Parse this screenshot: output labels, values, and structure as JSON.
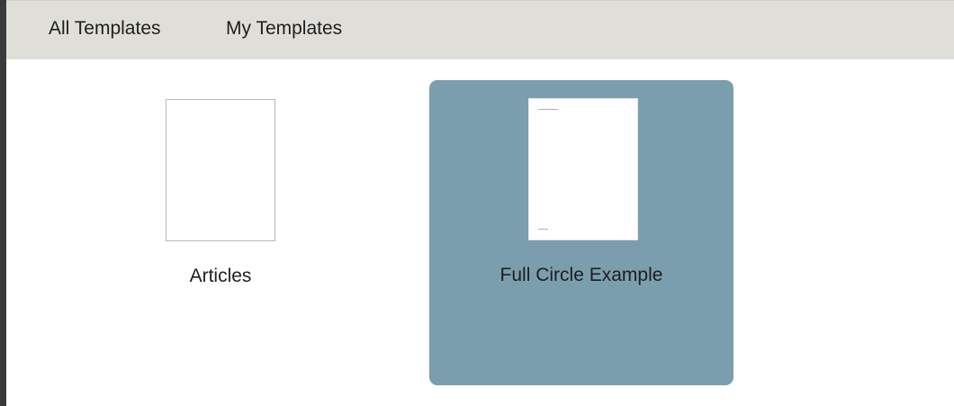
{
  "tabs": [
    {
      "label": "All Templates"
    },
    {
      "label": "My Templates"
    }
  ],
  "templates": [
    {
      "label": "Articles",
      "selected": false
    },
    {
      "label": "Full Circle Example",
      "selected": true
    }
  ],
  "colors": {
    "tabbar_background": "#dfded9",
    "selection_background": "#7b9eae",
    "left_border": "#3a3a3a",
    "text": "#1e1e1e"
  }
}
